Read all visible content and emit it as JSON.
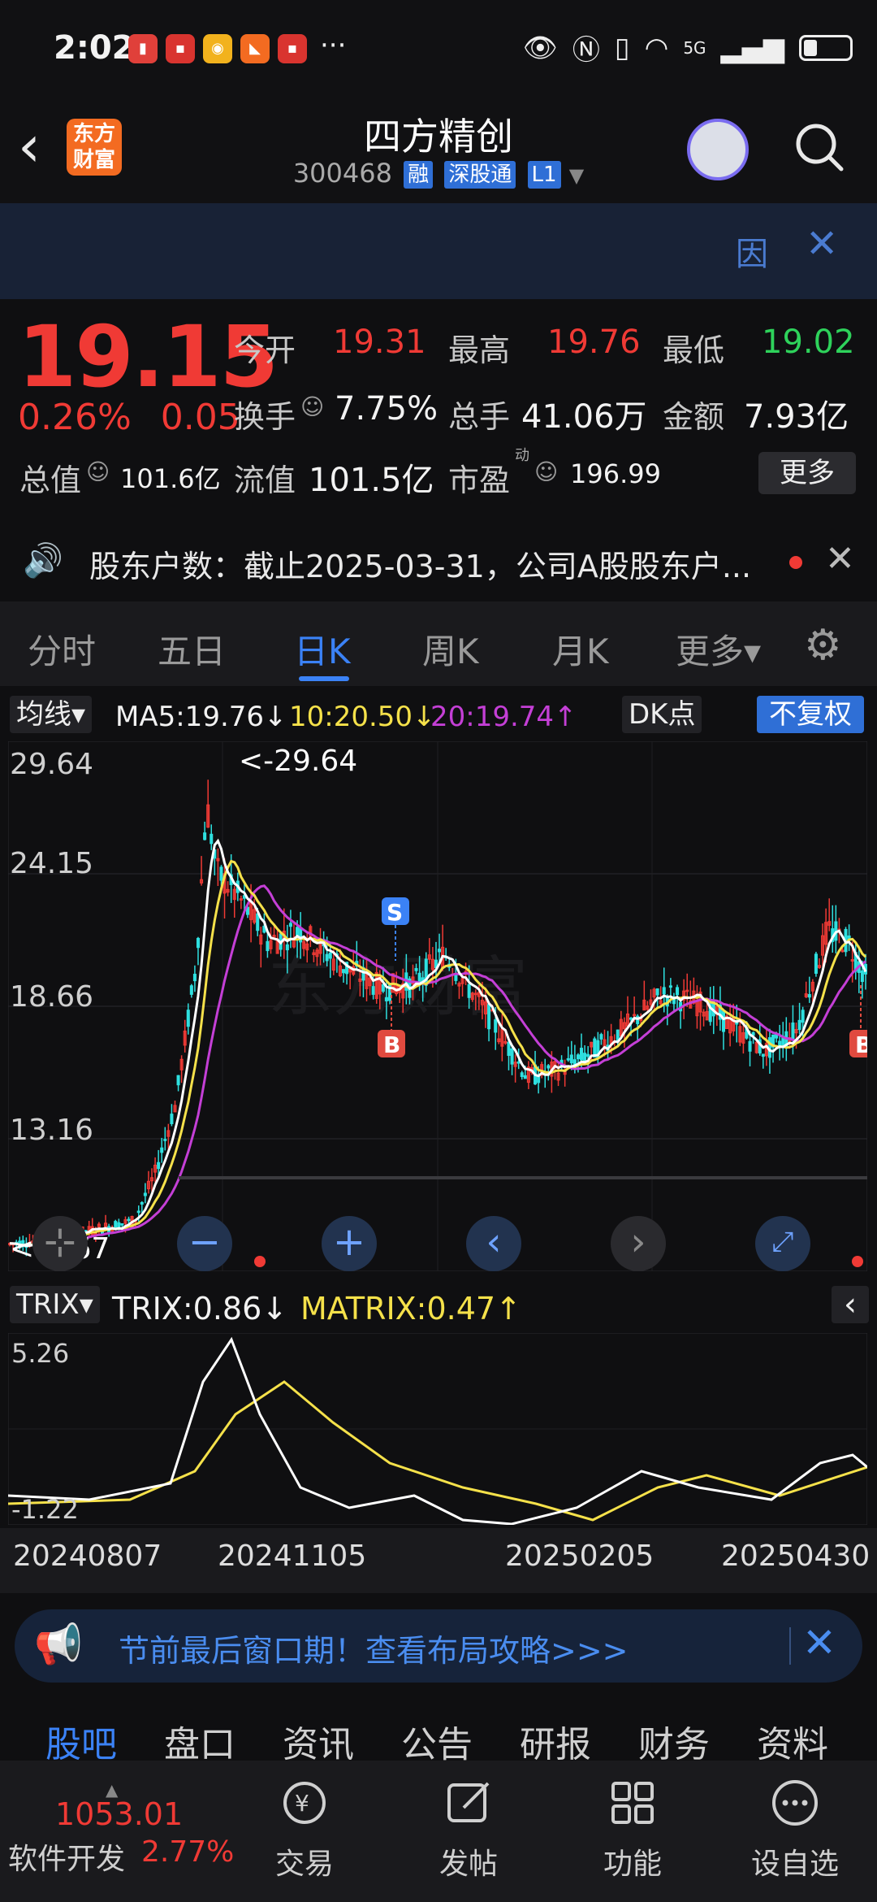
{
  "status_bar": {
    "time": "2:02",
    "more": "···",
    "network": "5G"
  },
  "header": {
    "title": "四方精创",
    "code": "300468",
    "tags": [
      "融",
      "深股通",
      "L1"
    ],
    "logo_text": "东方财富"
  },
  "banner": {
    "yin": "因",
    "close": "✕"
  },
  "quote": {
    "price": "19.15",
    "change_pct": "0.26%",
    "change": "0.05",
    "open_label": "今开",
    "open": "19.31",
    "high_label": "最高",
    "high": "19.76",
    "low_label": "最低",
    "low": "19.02",
    "turnover_label": "换手",
    "turnover": "7.75%",
    "volume_label": "总手",
    "volume": "41.06万",
    "amount_label": "金额",
    "amount": "7.93亿",
    "mcap_label": "总值",
    "mcap": "101.6亿",
    "float_label": "流值",
    "float": "101.5亿",
    "pe_label": "市盈",
    "pe_sup": "动",
    "pe": "196.99",
    "more": "更多"
  },
  "notice": {
    "text": "股东户数：截止2025-03-31，公司A股股东户...",
    "close": "✕"
  },
  "tabs": [
    "分时",
    "五日",
    "日K",
    "周K",
    "月K",
    "更多▾"
  ],
  "active_tab": "日K",
  "kline": {
    "indicator": "均线▾",
    "ma5": "MA5:19.76↓",
    "ma10": "10:20.50↓",
    "ma20": "20:19.74↑",
    "dk": "DK点",
    "fq": "不复权",
    "y_labels": [
      "29.64",
      "24.15",
      "18.66",
      "13.16"
    ],
    "max_marker": "<-29.64",
    "min_marker": "<-7.67",
    "watermark": "东方财富",
    "sell_label": "S",
    "buy_label": "B"
  },
  "trix": {
    "indicator": "TRIX▾",
    "trix": "TRIX:0.86↓",
    "matrix": "MATRIX:0.47↑",
    "y_top": "5.26",
    "y_bottom": "-1.22",
    "expand": "‹"
  },
  "dates": [
    "20240807",
    "20241105",
    "20250205",
    "20250430"
  ],
  "promo": {
    "text": "节前最后窗口期！查看布局攻略>>>",
    "close": "✕"
  },
  "bottom_tabs": [
    "股吧",
    "盘口",
    "资讯",
    "公告",
    "研报",
    "财务",
    "资料"
  ],
  "bottom_nav": {
    "index_value": "1053.01",
    "index_name": "软件开发",
    "index_pct": "2.77%",
    "items": [
      "交易",
      "发帖",
      "功能",
      "设自选"
    ]
  },
  "colors": {
    "up": "#f03a35",
    "down": "#2ed25b",
    "accent": "#3b82f6",
    "ma5": "#ffffff",
    "ma10": "#f5e14a",
    "ma20": "#c43fd6"
  }
}
